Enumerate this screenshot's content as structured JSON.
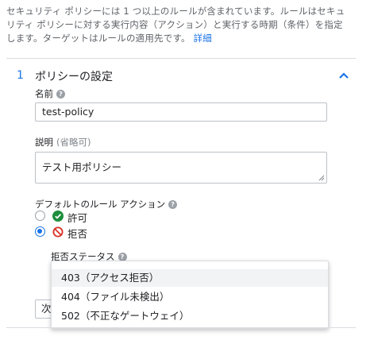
{
  "intro": {
    "line1": "セキュリティ ポリシーには 1 つ以上のルールが含まれています。ルールはセキュ",
    "line2": "リティ ポリシーに対する実行内容（アクション）と実行する時期（条件）を指定",
    "line3": "します。ターゲットはルールの適用先です。",
    "learn_more": "詳細"
  },
  "section": {
    "number": "1",
    "title": "ポリシーの設定",
    "collapse_icon": "chevron-up-icon"
  },
  "name_field": {
    "label": "名前",
    "help_icon": "help-icon",
    "value": "test-policy"
  },
  "description_field": {
    "label": "説明",
    "optional": "(省略可)",
    "value": "テスト用ポリシー"
  },
  "default_action": {
    "label": "デフォルトのルール アクション",
    "options": [
      {
        "label": "許可",
        "icon": "check-circle-icon",
        "selected": false
      },
      {
        "label": "拒否",
        "icon": "block-icon",
        "selected": true
      }
    ]
  },
  "deny_status": {
    "label": "拒否ステータス",
    "options": [
      "403（アクセス拒否）",
      "404（ファイル未検出）",
      "502（不正なゲートウェイ）"
    ],
    "highlighted_index": 0
  },
  "next_button": {
    "label": "次"
  },
  "colors": {
    "accent": "#1a73e8",
    "allow": "#1e8e3e",
    "deny": "#d93025",
    "muted_text": "#5f6368",
    "border": "#bdc1c6"
  }
}
